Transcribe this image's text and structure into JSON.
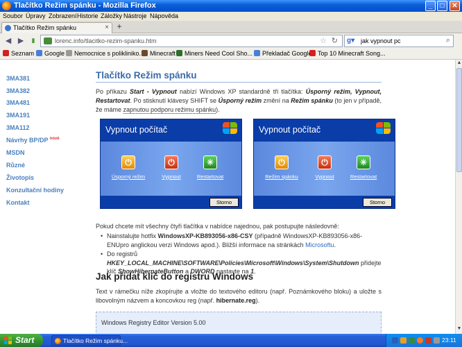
{
  "window": {
    "title": "Tlačítko Režim spánku - Mozilla Firefox",
    "minimize": "_",
    "maximize": "□",
    "close": "✕"
  },
  "menu": [
    "Soubor",
    "Úpravy",
    "Zobrazení",
    "Historie",
    "Záložky",
    "Nástroje",
    "Nápověda"
  ],
  "tab": {
    "label": "Tlačítko Režim spánku",
    "close": "×",
    "new_tab": "+"
  },
  "nav": {
    "back": "◄",
    "forward": "►",
    "url": "lorenc.info/tlacitko-rezim-spanku.htm",
    "search_value": "jak vypnout pc",
    "search_engine_icon": "google-icon"
  },
  "bookmarks": [
    {
      "label": "Seznam",
      "color": "#d42020"
    },
    {
      "label": "Google",
      "color": "#4a7fd8"
    },
    {
      "label": "Nemocnice s polikliniko...",
      "color": "#9a9a9a"
    },
    {
      "label": "Minecraft",
      "color": "#6b4a2a"
    },
    {
      "label": "Miners Need Cool Sho...",
      "color": "#2d6e2d"
    },
    {
      "label": "Překladač Google",
      "color": "#4a7fd8"
    },
    {
      "label": "Top 10 Minecraft Song...",
      "color": "#d42020"
    }
  ],
  "sidebar": {
    "items": [
      "3MA381",
      "3MA382",
      "3MA481",
      "3MA191",
      "3MA112",
      "Návrhy BP/DP",
      "MSDN",
      "Různé",
      "Životopis",
      "Konzultační hodiny",
      "Kontakt"
    ],
    "new_badge": "nové"
  },
  "article": {
    "title": "Tlačítko Režim spánku",
    "intro": {
      "p1": "Po příkazu ",
      "b1": "Start - Vypnout",
      "p2": " nabízí Windows XP standardně tři tlačítka: ",
      "b2": "Úsporný režim, Vypnout, Restartovat",
      "p3": ". Po stisknutí klávesy SHIFT se ",
      "b3": "Úsporný režim",
      "p4": " změní na ",
      "b4": "Režim spánku",
      "p5": " (to jen v případě, že máme ",
      "link": "zapnutou podporu režimu spánku",
      "p6": ")."
    },
    "dialogs": [
      {
        "title": "Vypnout počítač",
        "buttons": [
          "Úsporný režim",
          "Vypnout",
          "Restartovat"
        ],
        "cancel": "Storno"
      },
      {
        "title": "Vypnout počítač",
        "buttons": [
          "Režim spánku",
          "Vypnout",
          "Restartovat"
        ],
        "cancel": "Storno"
      }
    ],
    "para2": "Pokud chcete mít všechny čtyři tlačítka v nabídce najednou, pak postupujte následovně:",
    "bullet1": {
      "p1": "Nainstalujte hotfix ",
      "b1": "WindowsXP-KB893056-x86-CSY",
      "p2": " (případně WindowsXP-KB893056-x86-ENUpro anglickou verzi Windows apod.). Bližší informace na stránkách ",
      "link": "Microsoftu",
      "p3": "."
    },
    "bullet2": {
      "p1": "Do registrů ",
      "b1": "HKEY_LOCAL_MACHINE\\SOFTWARE\\Policies\\Microsoft\\Windows\\System\\Shutdown",
      "p2": " přidejte klíč ",
      "b2": "ShowHibernateButton",
      "p3": " a ",
      "b3": "DWORD",
      "p4": " nastavte na ",
      "b4": "1",
      "p5": "."
    },
    "subtitle": "Jak přidat klíč do registru Windows",
    "para3": {
      "p1": "Text v rámečku níže zkopírujte a vložte do textového editoru (např. Poznámkového bloku) a uložte s libovolným názvem a koncovkou reg (např. ",
      "b1": "hibernate.reg",
      "p2": ")."
    },
    "code": "Windows Registry Editor Version 5.00"
  },
  "taskbar": {
    "start": "Start",
    "task": "Tlačítko Režim spánku...",
    "clock": "23:11"
  }
}
